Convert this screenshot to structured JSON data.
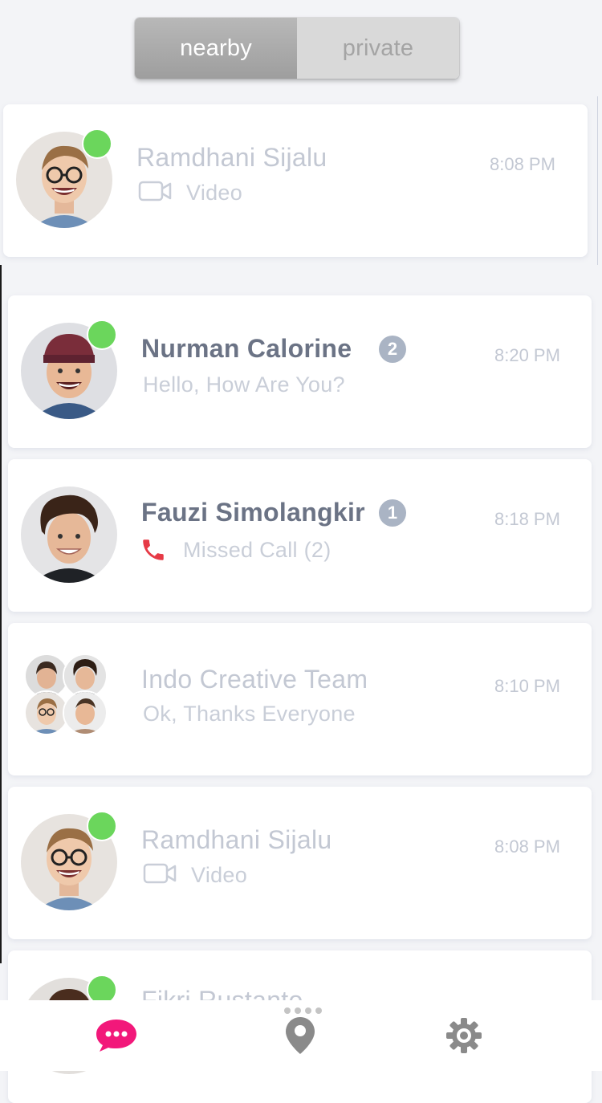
{
  "segment": {
    "tabs": [
      {
        "label": "nearby",
        "active": true
      },
      {
        "label": "private",
        "active": false
      }
    ]
  },
  "chats": [
    {
      "name": "Ramdhani Sijalu",
      "preview": "Video",
      "preview_icon": "video-icon",
      "time": "8:08 PM",
      "online": true,
      "unread": null
    },
    {
      "name": "Nurman Calorine",
      "preview": "Hello, How Are You?",
      "preview_icon": null,
      "time": "8:20 PM",
      "online": true,
      "unread": "2"
    },
    {
      "name": "Fauzi Simolangkir",
      "preview": "Missed Call (2)",
      "preview_icon": "phone-missed-icon",
      "time": "8:18 PM",
      "online": false,
      "unread": "1"
    },
    {
      "name": "Indo Creative Team",
      "preview": "Ok, Thanks Everyone",
      "preview_icon": null,
      "time": "8:10 PM",
      "online": false,
      "unread": null
    },
    {
      "name": "Ramdhani Sijalu",
      "preview": "Video",
      "preview_icon": "video-icon",
      "time": "8:08 PM",
      "online": true,
      "unread": null
    },
    {
      "name": "Fikri Rustanto",
      "preview": "",
      "preview_icon": null,
      "time": "",
      "online": true,
      "unread": null
    }
  ],
  "tabbar": {
    "items": [
      {
        "icon": "chat-bubble-icon",
        "active": true
      },
      {
        "icon": "location-pin-icon",
        "active": false
      },
      {
        "icon": "gear-icon",
        "active": false
      }
    ]
  },
  "colors": {
    "online": "#6bd65c",
    "missed_call": "#e63a46",
    "tab_active": "#f2187a",
    "tab_inactive": "#8a8a8a"
  }
}
